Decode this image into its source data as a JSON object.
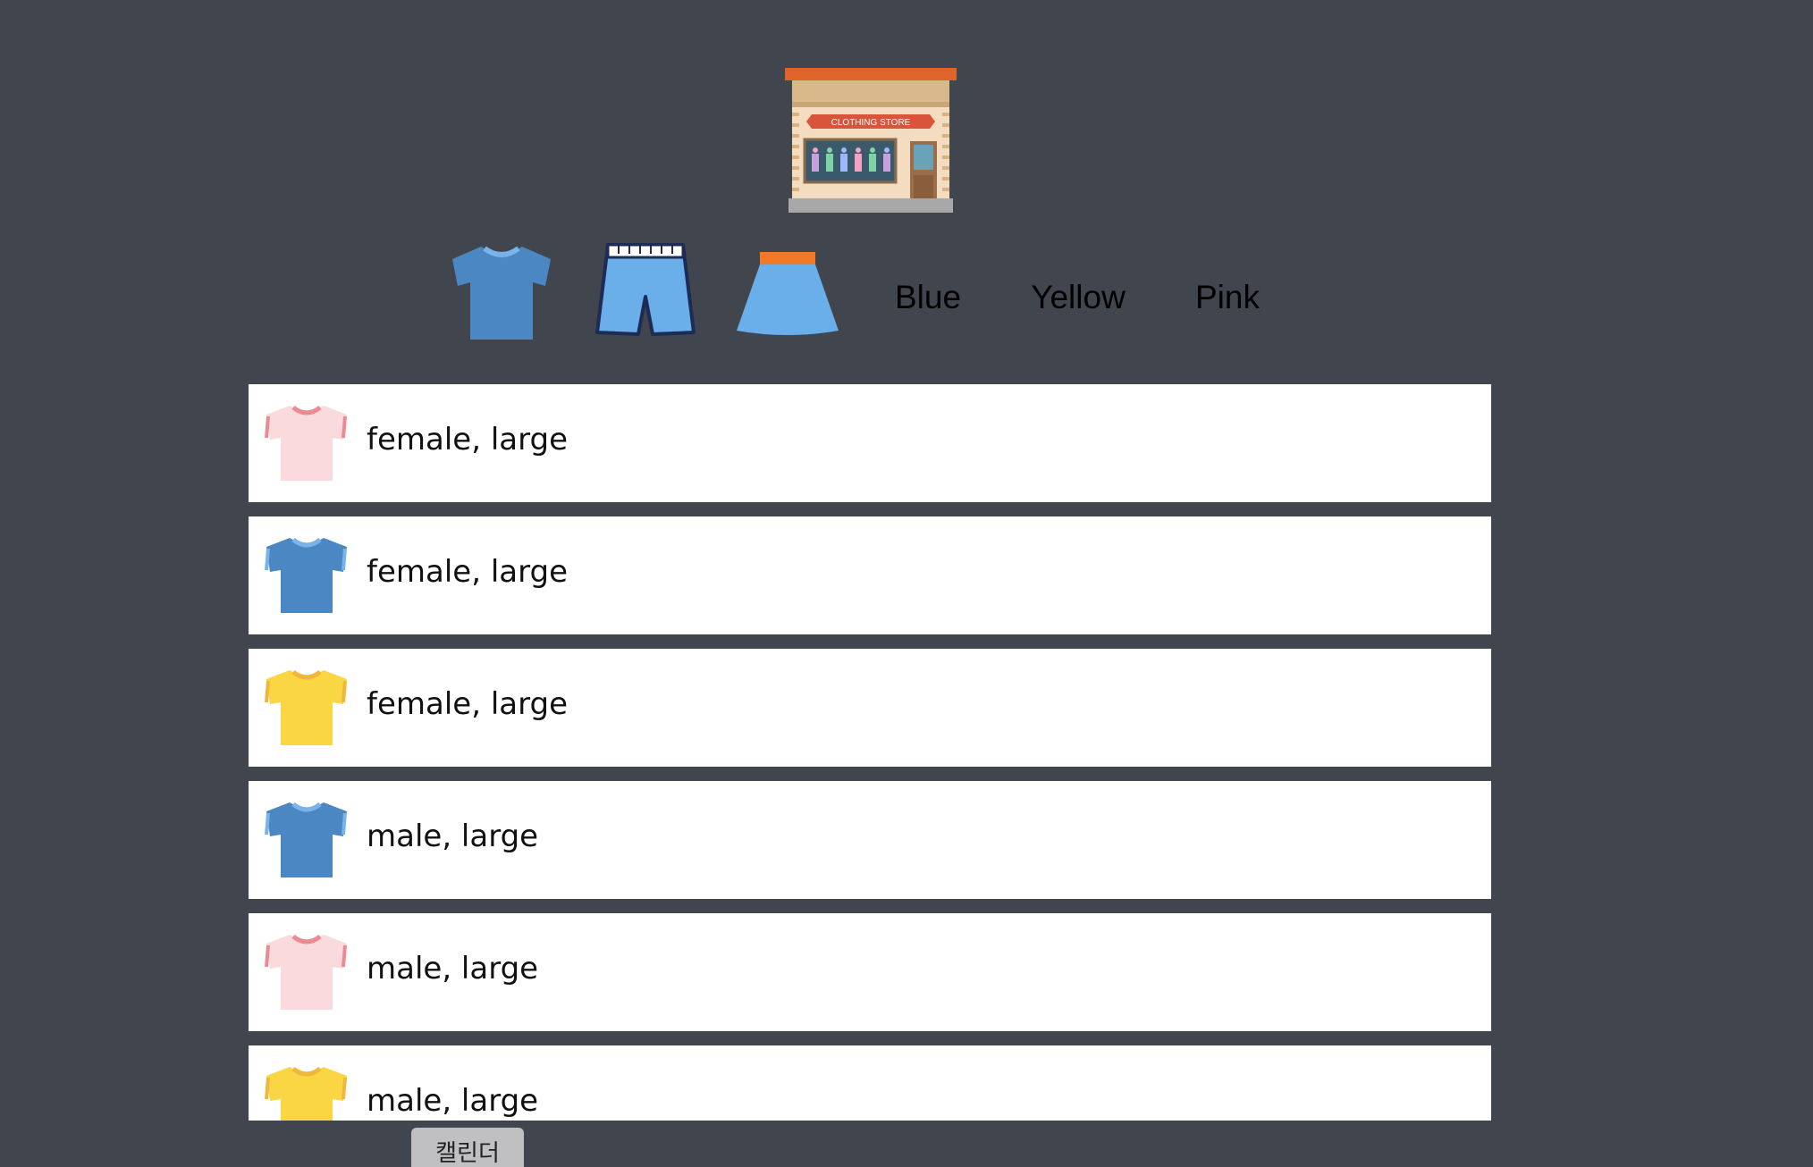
{
  "store_logo": {
    "icon": "clothing-store-icon",
    "sign_text": "CLOTHING STORE"
  },
  "filters": {
    "type_icons": [
      {
        "name": "tshirt-filter",
        "icon": "tshirt-icon",
        "color": "#4b87c2"
      },
      {
        "name": "pants-filter",
        "icon": "pants-icon",
        "color": "#6aaeea"
      },
      {
        "name": "skirt-filter",
        "icon": "skirt-icon",
        "color": "#6aaeea"
      }
    ],
    "colors": [
      {
        "label": "Blue",
        "color": "#4b87c2"
      },
      {
        "label": "Yellow",
        "color": "#f2c14e"
      },
      {
        "label": "Pink",
        "color": "#ee8888"
      }
    ]
  },
  "items": [
    {
      "text": "female, large",
      "shirt_color": "pink"
    },
    {
      "text": "female, large",
      "shirt_color": "blue"
    },
    {
      "text": "female, large",
      "shirt_color": "yellow"
    },
    {
      "text": "male, large",
      "shirt_color": "blue"
    },
    {
      "text": "male, large",
      "shirt_color": "pink"
    },
    {
      "text": "male, large",
      "shirt_color": "yellow"
    }
  ],
  "shirt_colors": {
    "pink": {
      "body": "#fadadd",
      "trim": "#ec8a8f"
    },
    "blue": {
      "body": "#4b87c2",
      "trim": "#79b3ea"
    },
    "yellow": {
      "body": "#fad645",
      "trim": "#f0b73a"
    }
  },
  "calendar_button": {
    "label": "캘린더"
  }
}
